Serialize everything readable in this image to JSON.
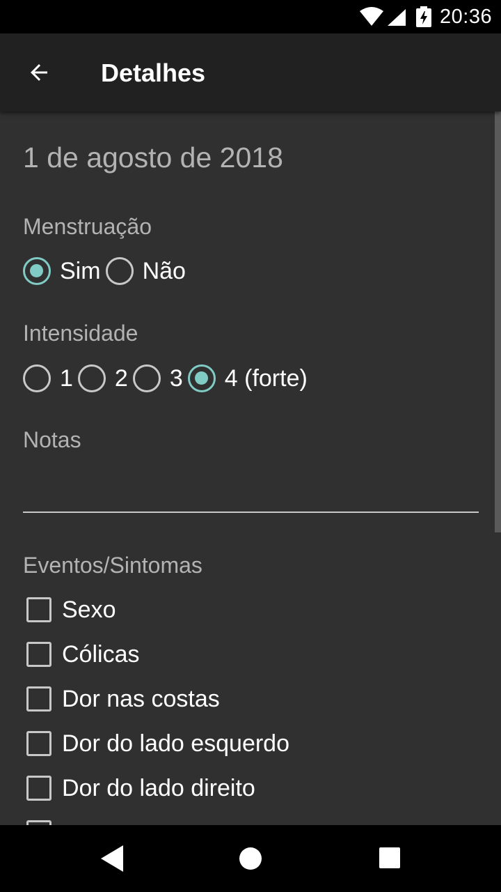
{
  "status_bar": {
    "time": "20:36",
    "icons": [
      "wifi-icon",
      "cell-signal-icon",
      "battery-charging-icon"
    ]
  },
  "app_bar": {
    "back_icon": "arrow-back-icon",
    "title": "Detalhes"
  },
  "details": {
    "date": "1 de agosto de 2018",
    "menstruation": {
      "label": "Menstruação",
      "options": [
        {
          "label": "Sim",
          "checked": true
        },
        {
          "label": "Não",
          "checked": false
        }
      ]
    },
    "intensity": {
      "label": "Intensidade",
      "options": [
        {
          "label": "1",
          "checked": false
        },
        {
          "label": "2",
          "checked": false
        },
        {
          "label": "3",
          "checked": false
        },
        {
          "label": "4 (forte)",
          "checked": true
        }
      ]
    },
    "notes": {
      "label": "Notas",
      "value": ""
    },
    "events": {
      "label": "Eventos/Sintomas",
      "items": [
        {
          "label": "Sexo",
          "checked": false
        },
        {
          "label": "Cólicas",
          "checked": false
        },
        {
          "label": "Dor nas costas",
          "checked": false
        },
        {
          "label": "Dor do lado esquerdo",
          "checked": false
        },
        {
          "label": "Dor do lado direito",
          "checked": false
        }
      ]
    }
  },
  "colors": {
    "accent": "#80cbc4",
    "app_bar": "#212121",
    "background": "#303030",
    "secondary_text": "#b3b3b3"
  },
  "nav_bar": {
    "icons": [
      "nav-back-icon",
      "nav-home-icon",
      "nav-recents-icon"
    ]
  }
}
